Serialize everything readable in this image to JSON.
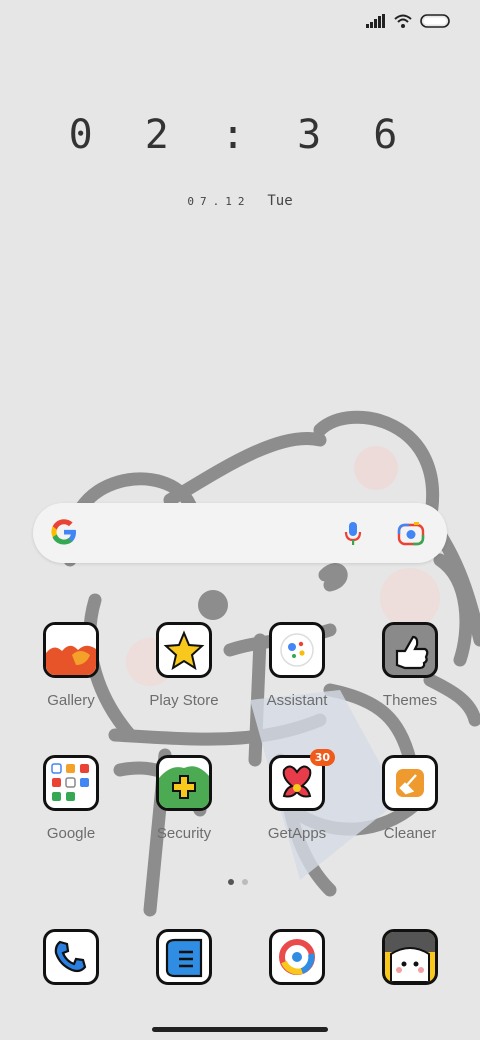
{
  "status_bar": {
    "icons": [
      "signal-icon",
      "wifi-icon",
      "battery-icon"
    ]
  },
  "clock": {
    "time": "0 2 : 3 6"
  },
  "date": {
    "day": "07.12",
    "weekday": "Tue"
  },
  "search_bar": {
    "icons": [
      "google-logo-icon",
      "mic-icon",
      "lens-icon"
    ]
  },
  "apps_row1": [
    {
      "label": "Gallery"
    },
    {
      "label": "Play Store"
    },
    {
      "label": "Assistant"
    },
    {
      "label": "Themes"
    }
  ],
  "apps_row2": [
    {
      "label": "Google"
    },
    {
      "label": "Security"
    },
    {
      "label": "GetApps",
      "badge": "30"
    },
    {
      "label": "Cleaner"
    }
  ],
  "dock": [
    "phone-icon",
    "messages-icon",
    "browser-icon",
    "camera-icon"
  ],
  "page_indicator": {
    "pages": 2,
    "active": 1
  },
  "colors": {
    "background": "#e6e6e6",
    "badge": "#f05a1a",
    "text": "#6d6d6d"
  }
}
